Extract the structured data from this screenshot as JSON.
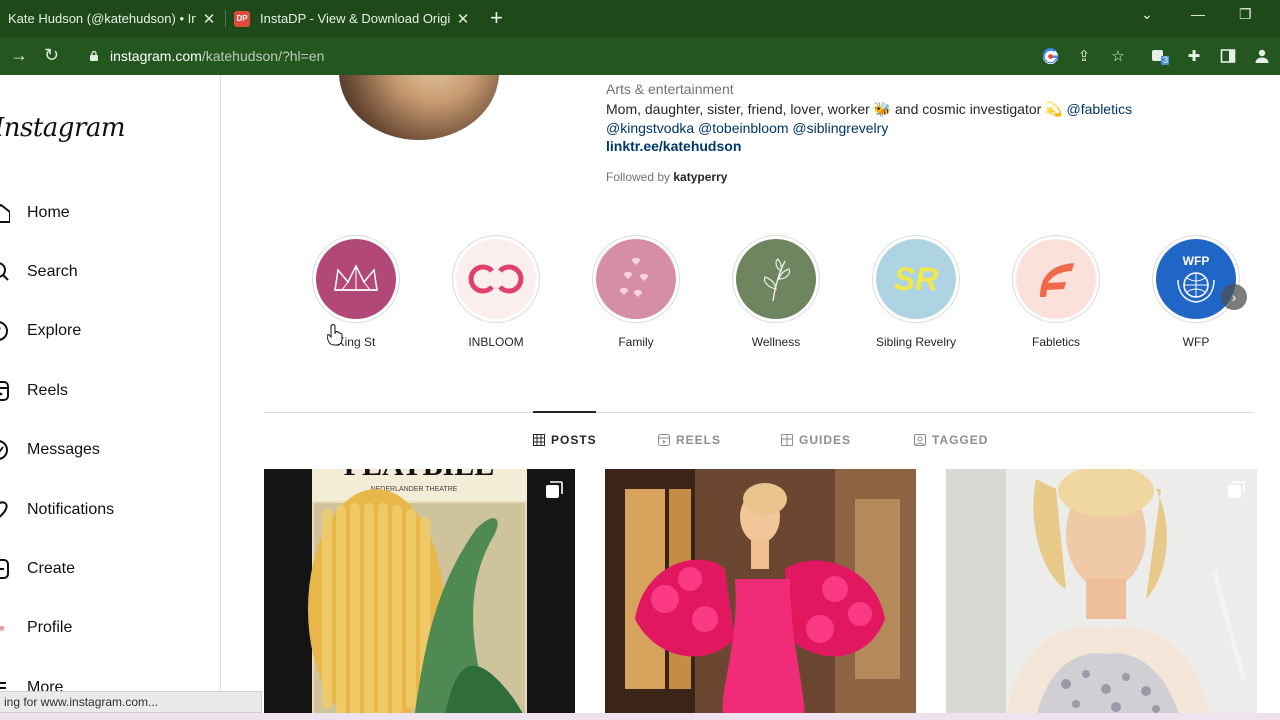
{
  "browser": {
    "tabs": [
      {
        "title": "Kate Hudson (@katehudson) • Instagram"
      },
      {
        "title": "InstaDP - View & Download Original"
      }
    ],
    "favicon_text": "DP",
    "url_host": "instagram.com",
    "url_path": "/katehudson/?hl=en",
    "extension_badge": "3",
    "status_text": "ing for www.instagram.com..."
  },
  "sidebar": {
    "logo": "Instagram",
    "items": [
      {
        "label": "Home"
      },
      {
        "label": "Search"
      },
      {
        "label": "Explore"
      },
      {
        "label": "Reels"
      },
      {
        "label": "Messages"
      },
      {
        "label": "Notifications"
      },
      {
        "label": "Create"
      },
      {
        "label": "Profile"
      },
      {
        "label": "More"
      }
    ]
  },
  "profile": {
    "category": "Arts & entertainment",
    "bio_line1_a": "Mom, daughter, sister, friend, lover, worker ",
    "bio_line1_b": " and cosmic investigator ",
    "bio_line1_tag": "@fabletics",
    "bio_tags_line2": "@kingstvodka @tobeinbloom @siblingrevelry",
    "link": "linktr.ee/katehudson",
    "followed_prefix": "Followed by ",
    "followed_by": "katyperry",
    "emoji_bee": "🐝",
    "emoji_moon": "💫"
  },
  "highlights": [
    {
      "label": "King St",
      "color": "#b24877",
      "glyph": "♛"
    },
    {
      "label": "INBLOOM",
      "color": "#fbeeee",
      "glyph": "CO"
    },
    {
      "label": "Family",
      "color": "#d58ea3",
      "glyph": "♥"
    },
    {
      "label": "Wellness",
      "color": "#6f8560",
      "glyph": "❦"
    },
    {
      "label": "Sibling Revelry",
      "color": "#aed3e2",
      "glyph": "SR"
    },
    {
      "label": "Fabletics",
      "color": "#fbe0dc",
      "glyph": "F"
    },
    {
      "label": "WFP",
      "color": "#1f66c7",
      "glyph": "WFP"
    }
  ],
  "post_tabs": [
    {
      "label": "POSTS"
    },
    {
      "label": "REELS"
    },
    {
      "label": "GUIDES"
    },
    {
      "label": "TAGGED"
    }
  ],
  "posts": [
    {
      "top_text": "PLAYBILL",
      "sub_text": "NEDERLANDER THEATRE"
    },
    {},
    {}
  ]
}
